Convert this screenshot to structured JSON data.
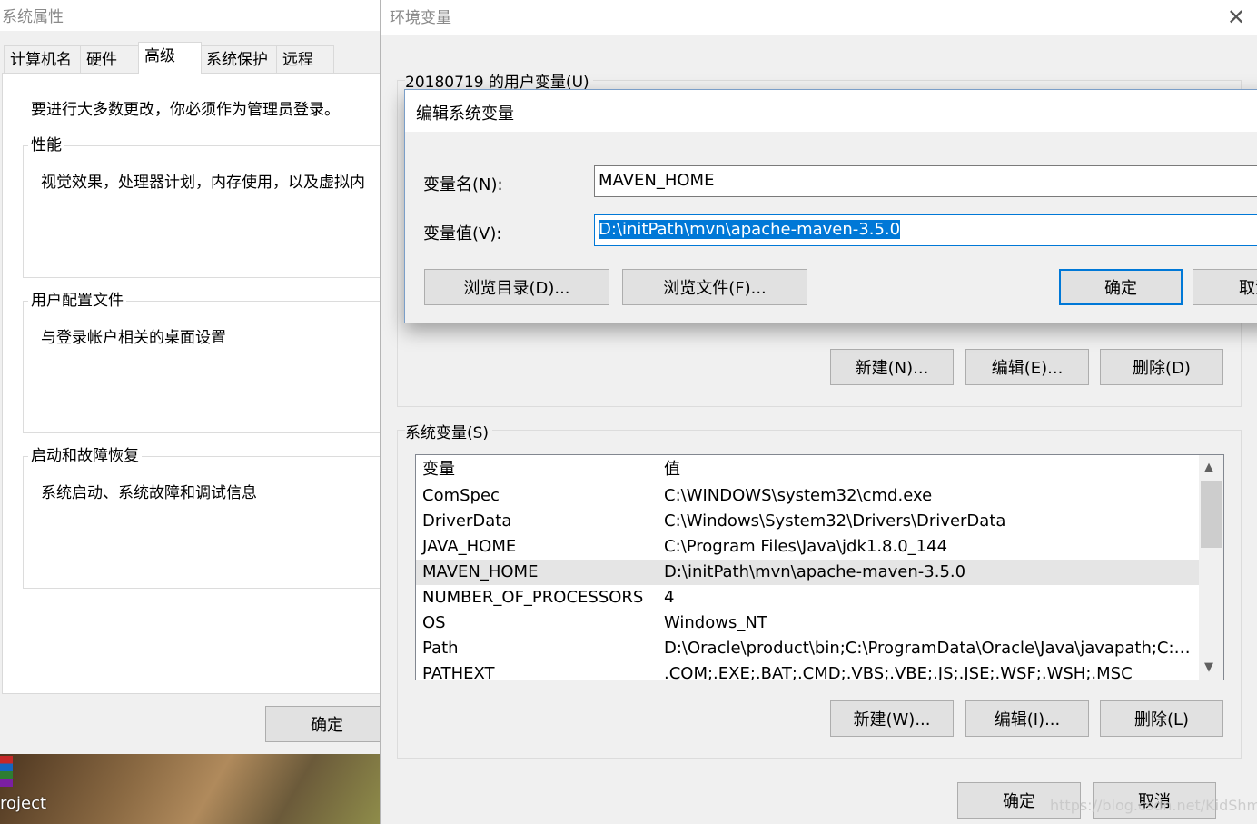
{
  "system_properties": {
    "title": "系统属性",
    "tabs": [
      {
        "label": "计算机名"
      },
      {
        "label": "硬件"
      },
      {
        "label": "高级"
      },
      {
        "label": "系统保护"
      },
      {
        "label": "远程"
      }
    ],
    "active_tab": "高级",
    "admin_note": "要进行大多数更改，你必须作为管理员登录。",
    "groups": [
      {
        "title": "性能",
        "text": "视觉效果，处理器计划，内存使用，以及虚拟内"
      },
      {
        "title": "用户配置文件",
        "text": "与登录帐户相关的桌面设置"
      },
      {
        "title": "启动和故障恢复",
        "text": "系统启动、系统故障和调试信息"
      }
    ],
    "ok_label": "确定"
  },
  "desktop": {
    "icon_label": "roject"
  },
  "env_vars": {
    "title": "环境变量",
    "user_section_label": "20180719 的用户变量(U)",
    "user_buttons": {
      "new": "新建(N)...",
      "edit": "编辑(E)...",
      "delete": "删除(D)"
    },
    "system_section_label": "系统变量(S)",
    "columns": {
      "name": "变量",
      "value": "值"
    },
    "system_vars": [
      {
        "name": "ComSpec",
        "value": "C:\\WINDOWS\\system32\\cmd.exe"
      },
      {
        "name": "DriverData",
        "value": "C:\\Windows\\System32\\Drivers\\DriverData"
      },
      {
        "name": "JAVA_HOME",
        "value": "C:\\Program Files\\Java\\jdk1.8.0_144"
      },
      {
        "name": "MAVEN_HOME",
        "value": "D:\\initPath\\mvn\\apache-maven-3.5.0"
      },
      {
        "name": "NUMBER_OF_PROCESSORS",
        "value": "4"
      },
      {
        "name": "OS",
        "value": "Windows_NT"
      },
      {
        "name": "Path",
        "value": "D:\\Oracle\\product\\bin;C:\\ProgramData\\Oracle\\Java\\javapath;C:\\W..."
      },
      {
        "name": "PATHEXT",
        "value": ".COM;.EXE;.BAT;.CMD;.VBS;.VBE;.JS;.JSE;.WSF;.WSH;.MSC"
      }
    ],
    "selected_row": "MAVEN_HOME",
    "system_buttons": {
      "new": "新建(W)...",
      "edit": "编辑(I)...",
      "delete": "删除(L)"
    },
    "ok_label": "确定",
    "cancel_label": "取消"
  },
  "edit_dialog": {
    "title": "编辑系统变量",
    "name_label": "变量名(N):",
    "name_value": "MAVEN_HOME",
    "value_label": "变量值(V):",
    "value_value": "D:\\initPath\\mvn\\apache-maven-3.5.0",
    "browse_dir_label": "浏览目录(D)...",
    "browse_file_label": "浏览文件(F)...",
    "ok_label": "确定",
    "cancel_label": "取消"
  },
  "watermark": "https://blog.csdn.net/KidShmily",
  "colors": {
    "accent": "#0078d7",
    "selection_row": "#e5e5e5"
  }
}
